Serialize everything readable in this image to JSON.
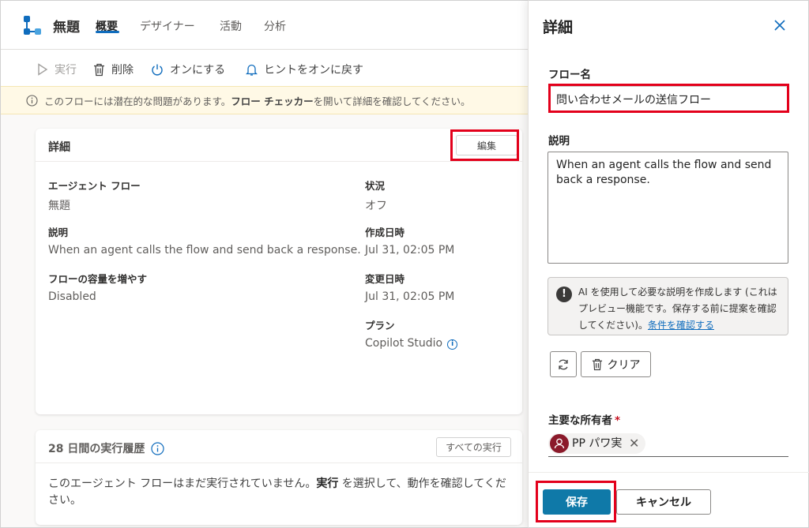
{
  "header": {
    "flow_title": "無題",
    "tabs": [
      {
        "label": "概要",
        "active": true
      },
      {
        "label": "デザイナー",
        "active": false
      },
      {
        "label": "活動",
        "active": false
      },
      {
        "label": "分析",
        "active": false
      }
    ]
  },
  "toolbar": {
    "run": "実行",
    "delete": "削除",
    "turn_on": "オンにする",
    "hints": "ヒントをオンに戻す"
  },
  "banner": {
    "text_before": "このフローには潜在的な問題があります。",
    "bold": "フロー チェッカー",
    "text_after": " を開いて詳細を確認してください。"
  },
  "details_card": {
    "title": "詳細",
    "edit_label": "編集",
    "fields": {
      "agent_flow": {
        "label": "エージェント フロー",
        "value": "無題"
      },
      "description": {
        "label": "説明",
        "value": "When an agent calls the flow and send back a response."
      },
      "capacity": {
        "label": "フローの容量を増やす",
        "value": "Disabled"
      },
      "status": {
        "label": "状況",
        "value": "オフ"
      },
      "created": {
        "label": "作成日時",
        "value": "Jul 31, 02:05 PM"
      },
      "modified": {
        "label": "変更日時",
        "value": "Jul 31, 02:05 PM"
      },
      "plan": {
        "label": "プラン",
        "value": "Copilot Studio"
      }
    }
  },
  "history_card": {
    "title": "28 日間の実行履歴",
    "all_runs_label": "すべての実行",
    "message_before": "このエージェント フローはまだ実行されていません。",
    "message_bold": "実行",
    "message_after": " を選択して、動作を確認してください。"
  },
  "panel": {
    "title": "詳細",
    "flow_name_label": "フロー名",
    "flow_name_value": "問い合わせメールの送信フロー",
    "description_label": "説明",
    "description_value": "When an agent calls the flow and send back a response.",
    "ai_note_text": "AI を使用して必要な説明を作成します (これはプレビュー機能です。保存する前に提案を確認してください)。",
    "ai_note_link": "条件を確認する",
    "clear_label": "クリア",
    "owner_label": "主要な所有者",
    "owner_required": "*",
    "owner_name": "PP パワ実",
    "save_label": "保存",
    "cancel_label": "キャンセル"
  },
  "colors": {
    "accent": "#0f6cbd",
    "save_button": "#0f79a8",
    "highlight_box": "#e3001b",
    "banner_bg": "#fff9e6",
    "avatar": "#8b1a2b"
  }
}
